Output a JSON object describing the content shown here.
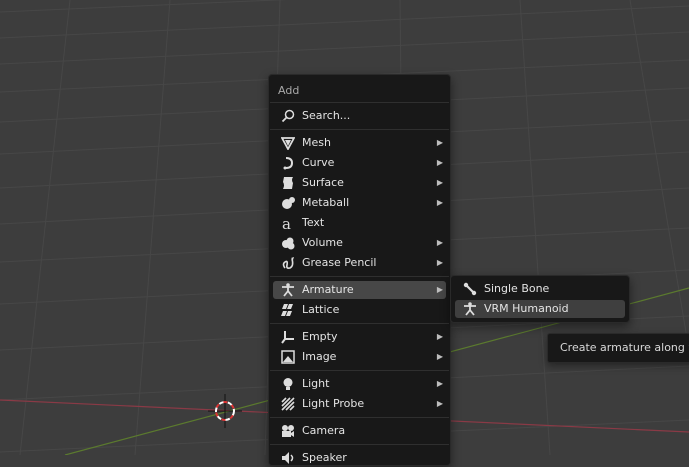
{
  "add_menu": {
    "title": "Add",
    "search_label": "Search...",
    "items": [
      {
        "label": "Mesh",
        "icon": "mesh-icon",
        "submenu": true
      },
      {
        "label": "Curve",
        "icon": "curve-icon",
        "submenu": true
      },
      {
        "label": "Surface",
        "icon": "surface-icon",
        "submenu": true
      },
      {
        "label": "Metaball",
        "icon": "metaball-icon",
        "submenu": true
      },
      {
        "label": "Text",
        "icon": "text-icon",
        "submenu": false
      },
      {
        "label": "Volume",
        "icon": "volume-icon",
        "submenu": true
      },
      {
        "label": "Grease Pencil",
        "icon": "grease-pencil-icon",
        "submenu": true
      },
      {
        "label": "Armature",
        "icon": "armature-icon",
        "submenu": true,
        "active": true
      },
      {
        "label": "Lattice",
        "icon": "lattice-icon",
        "submenu": false
      },
      {
        "label": "Empty",
        "icon": "empty-icon",
        "submenu": true
      },
      {
        "label": "Image",
        "icon": "image-icon",
        "submenu": true
      },
      {
        "label": "Light",
        "icon": "light-icon",
        "submenu": true
      },
      {
        "label": "Light Probe",
        "icon": "light-probe-icon",
        "submenu": true
      },
      {
        "label": "Camera",
        "icon": "camera-icon",
        "submenu": false
      },
      {
        "label": "Speaker",
        "icon": "speaker-icon",
        "submenu": false
      }
    ]
  },
  "armature_submenu": {
    "items": [
      {
        "label": "Single Bone",
        "icon": "bone-icon"
      },
      {
        "label": "VRM Humanoid",
        "icon": "armature-icon",
        "highlighted": true
      }
    ]
  },
  "tooltip": {
    "text": "Create armature along w"
  },
  "colors": {
    "viewport_bg": "#3d3d3d",
    "grid_line": "#474747",
    "x_axis": "#8a3a46",
    "y_axis": "#5b7a2e",
    "menu_bg": "#181818",
    "active_item": "#474747"
  }
}
